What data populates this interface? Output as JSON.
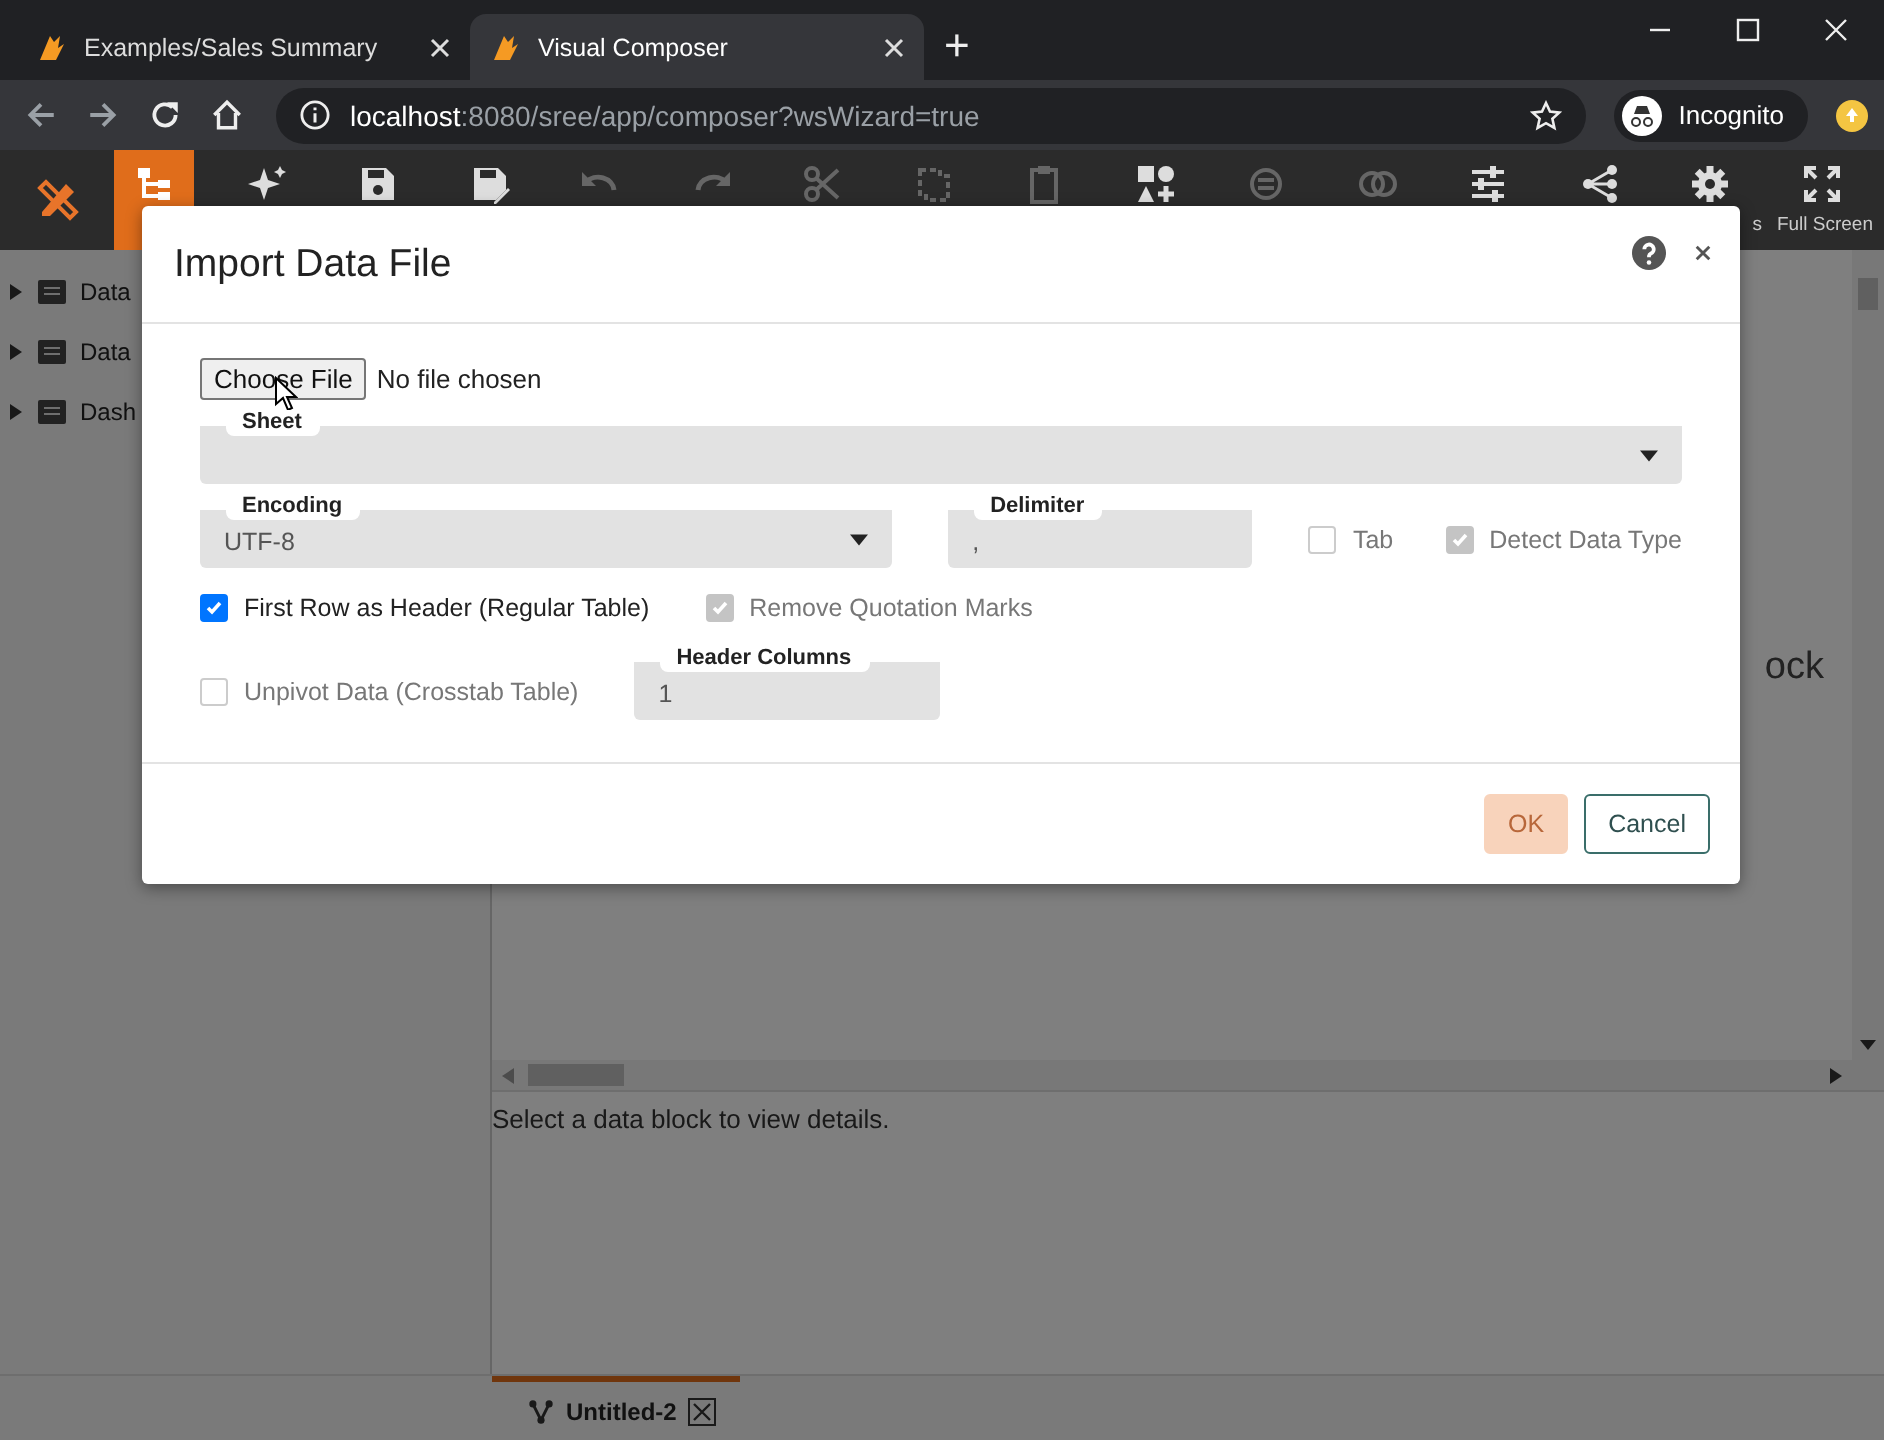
{
  "browser": {
    "tabs": [
      {
        "title": "Examples/Sales Summary",
        "selected": false
      },
      {
        "title": "Visual Composer",
        "selected": true
      }
    ],
    "new_tab": "+",
    "address": {
      "host": "localhost",
      "rest": ":8080/sree/app/composer?wsWizard=true"
    },
    "profile": "Incognito"
  },
  "toolbar": {
    "buttons": [
      {
        "selected": true,
        "disabled": false
      },
      {
        "selected": false,
        "disabled": false
      },
      {
        "selected": false,
        "disabled": false
      },
      {
        "selected": false,
        "disabled": false
      },
      {
        "selected": false,
        "disabled": true
      },
      {
        "selected": false,
        "disabled": true
      },
      {
        "selected": false,
        "disabled": true
      },
      {
        "selected": false,
        "disabled": true
      },
      {
        "selected": false,
        "disabled": true
      },
      {
        "selected": false,
        "disabled": false
      },
      {
        "selected": false,
        "disabled": true
      },
      {
        "selected": false,
        "disabled": true
      },
      {
        "selected": false,
        "disabled": false
      },
      {
        "selected": false,
        "disabled": false
      },
      {
        "selected": false,
        "disabled": false,
        "label": "s"
      },
      {
        "selected": false,
        "disabled": false,
        "label": "Full Screen"
      }
    ]
  },
  "sidebar": {
    "items": [
      {
        "label": "Data",
        "expanded": false
      },
      {
        "label": "Data",
        "expanded": false
      },
      {
        "label": "Dash",
        "expanded": false
      }
    ]
  },
  "canvas": {
    "message": "ock"
  },
  "details": {
    "message": "Select a data block to view details."
  },
  "bottom_tabs": [
    {
      "title": "Untitled-2",
      "selected": true
    }
  ],
  "dialog": {
    "title": "Import Data File",
    "file": {
      "button": "Choose File",
      "status": "No file chosen"
    },
    "sheet": {
      "label": "Sheet"
    },
    "encoding": {
      "label": "Encoding",
      "value": "UTF-8"
    },
    "delimiter": {
      "label": "Delimiter",
      "value": ","
    },
    "options": [
      {
        "label": "Tab",
        "checked": false,
        "disabled": true
      },
      {
        "label": "Detect Data Type",
        "checked": true,
        "disabled": true
      },
      {
        "label": "First Row as Header (Regular Table)",
        "checked": true,
        "disabled": false
      },
      {
        "label": "Remove Quotation Marks",
        "checked": true,
        "disabled": true
      },
      {
        "label": "Unpivot Data (Crosstab Table)",
        "checked": false,
        "disabled": true
      }
    ],
    "header_columns": {
      "label": "Header Columns",
      "value": "1"
    },
    "buttons": [
      {
        "label": "OK",
        "kind": "primary",
        "disabled": true
      },
      {
        "label": "Cancel",
        "kind": "secondary",
        "disabled": false
      }
    ]
  }
}
